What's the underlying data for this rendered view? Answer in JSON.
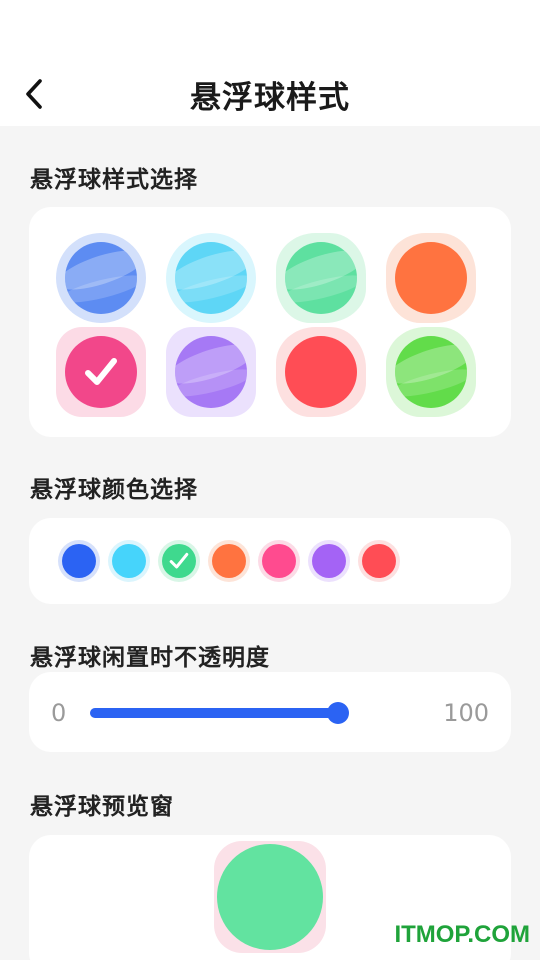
{
  "header": {
    "title": "悬浮球样式"
  },
  "styles": {
    "title": "悬浮球样式选择",
    "items": [
      {
        "name": "blue-swirl",
        "frame": "circle",
        "frame_color": "#d3e0fb",
        "ball_color": "#5d8cf2",
        "swirl": true,
        "selected": false
      },
      {
        "name": "cyan-swirl",
        "frame": "circle",
        "frame_color": "#d9f6fd",
        "ball_color": "#5ed6f6",
        "swirl": true,
        "selected": false
      },
      {
        "name": "green-swirl",
        "frame": "blob",
        "frame_color": "#dcf7e7",
        "ball_color": "#5ee0a0",
        "swirl": true,
        "selected": false
      },
      {
        "name": "orange-solid",
        "frame": "blob",
        "frame_color": "#fde3d8",
        "ball_color": "#ff7340",
        "swirl": false,
        "selected": false
      },
      {
        "name": "pink-solid",
        "frame": "squircle",
        "frame_color": "#fcdbe6",
        "ball_color": "#f2478a",
        "swirl": false,
        "selected": true
      },
      {
        "name": "purple-swirl",
        "frame": "squircle",
        "frame_color": "#ebe1fd",
        "ball_color": "#a679f5",
        "swirl": true,
        "selected": false
      },
      {
        "name": "red-solid",
        "frame": "blob",
        "frame_color": "#fde0e0",
        "ball_color": "#ff4d55",
        "swirl": false,
        "selected": false
      },
      {
        "name": "lime-swirl",
        "frame": "blob",
        "frame_color": "#dcf7d8",
        "ball_color": "#62dc4a",
        "swirl": true,
        "selected": false
      }
    ]
  },
  "colors": {
    "title": "悬浮球颜色选择",
    "items": [
      {
        "name": "blue",
        "color": "#2b63f3",
        "ring": "#d6e1fb",
        "selected": false
      },
      {
        "name": "cyan",
        "color": "#46d4fb",
        "ring": "#dbf5fd",
        "selected": false
      },
      {
        "name": "green",
        "color": "#3fd98e",
        "ring": "#d9f6e7",
        "selected": true
      },
      {
        "name": "orange",
        "color": "#ff7340",
        "ring": "#fde4d8",
        "selected": false
      },
      {
        "name": "pink",
        "color": "#ff4b8f",
        "ring": "#fcdbe6",
        "selected": false
      },
      {
        "name": "purple",
        "color": "#a463f5",
        "ring": "#ece1fd",
        "selected": false
      },
      {
        "name": "red",
        "color": "#ff4d55",
        "ring": "#fde0e0",
        "selected": false
      }
    ]
  },
  "opacity": {
    "title": "悬浮球闲置时不透明度",
    "min_label": "0",
    "max_label": "100",
    "value": 100,
    "accent": "#2b63f3"
  },
  "preview": {
    "title": "悬浮球预览窗",
    "ball_color": "#62e3a0",
    "frame_color": "#fbe1e8"
  },
  "watermark": "ITMOP.COM"
}
